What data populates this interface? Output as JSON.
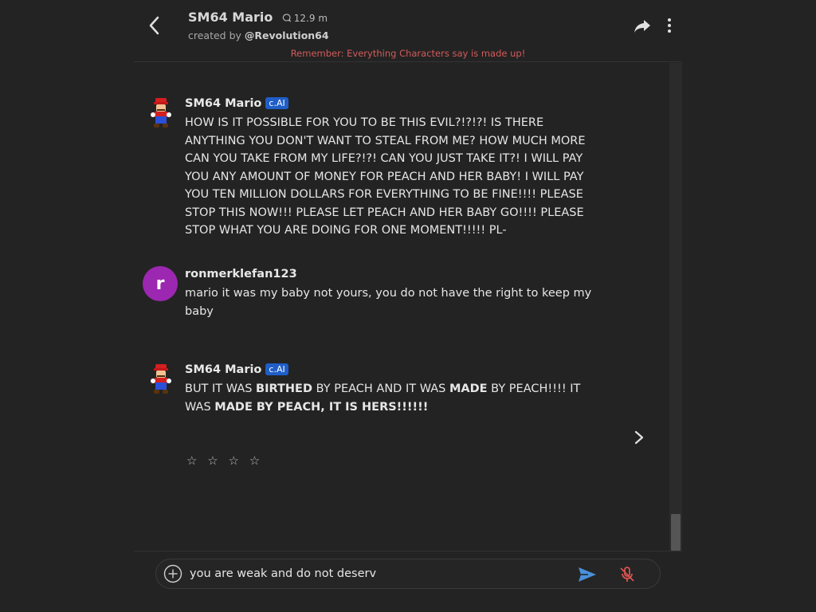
{
  "header": {
    "title": "SM64 Mario",
    "chat_count": "12.9 m",
    "created_by_prefix": "created by",
    "creator": "@Revolution64",
    "disclaimer": "Remember: Everything Characters say is made up!"
  },
  "messages": [
    {
      "sender": "SM64 Mario",
      "badge": "c.AI",
      "text": "HOW IS IT POSSIBLE FOR YOU TO BE THIS EVIL?!?!?! IS THERE ANYTHING YOU DON'T WANT TO STEAL FROM ME? HOW MUCH MORE CAN YOU TAKE FROM MY LIFE?!?! CAN YOU JUST TAKE IT?! I WILL PAY YOU ANY AMOUNT OF MONEY FOR PEACH AND HER BABY! I WILL PAY YOU TEN MILLION DOLLARS FOR EVERYTHING TO BE FINE!!!! PLEASE STOP THIS NOW!!! PLEASE LET PEACH AND HER BABY GO!!!! PLEASE STOP WHAT YOU ARE DOING FOR ONE MOMENT!!!!! PL-"
    },
    {
      "sender": "ronmerklefan123",
      "avatar_letter": "r",
      "text": "mario it was my baby not yours, you do not have the right to keep my baby"
    },
    {
      "sender": "SM64 Mario",
      "badge": "c.AI",
      "text_parts": [
        "BUT IT WAS ",
        "BIRTHED",
        " BY PEACH AND IT WAS ",
        "MADE",
        " BY PEACH!!!! IT WAS ",
        "MADE BY PEACH, IT IS HERS!!!!!!"
      ]
    }
  ],
  "rating": {
    "stars": [
      "☆",
      "☆",
      "☆",
      "☆"
    ]
  },
  "composer": {
    "value": "you are weak and do not deserv"
  },
  "icons": {
    "back": "chevron-left-icon",
    "share": "share-icon",
    "more": "more-vertical-icon",
    "next": "chevron-right-icon",
    "plus": "plus-circle-icon",
    "send": "send-icon",
    "mic": "mic-off-icon"
  },
  "colors": {
    "background": "#232323",
    "disclaimer": "#d45a5a",
    "badge": "#1f5ec8",
    "user_avatar": "#9c27b0",
    "send": "#4a90d9",
    "mic_off": "#d9534f"
  }
}
